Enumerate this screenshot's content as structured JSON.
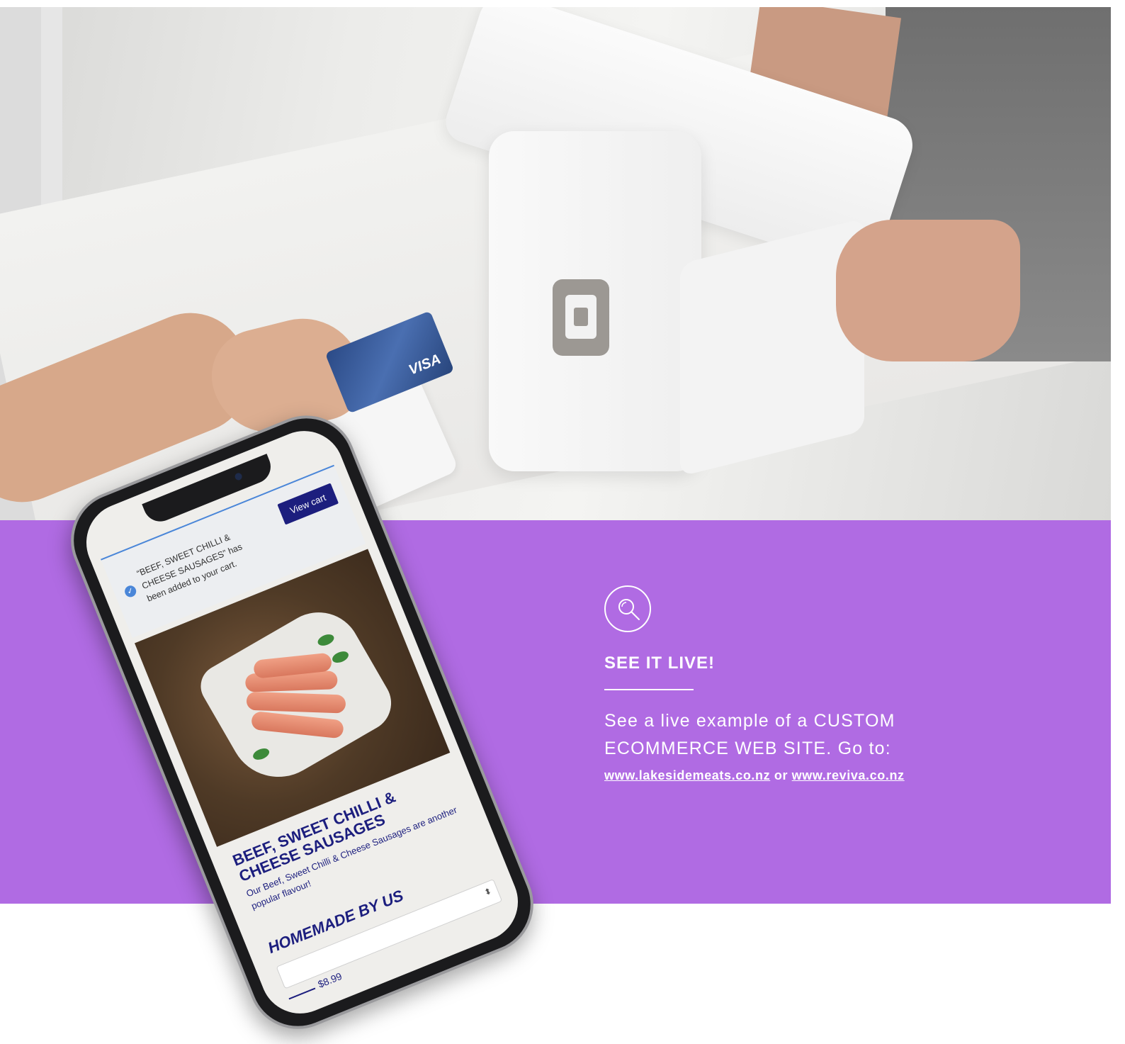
{
  "phone_screen": {
    "notice_message": "“BEEF, SWEET CHILLI & CHEESE SAUSAGES” has been added to your cart.",
    "check_glyph": "✓",
    "view_cart_label": "View cart",
    "product_title": "BEEF, SWEET CHILLI & CHEESE SAUSAGES",
    "product_description": "Our Beef, Sweet Chilli & Cheese Sausages are another popular flavour!",
    "section_heading": "HOMEMADE BY US",
    "select_arrow_glyph": "⬍",
    "price": "$8.99"
  },
  "cta": {
    "icon": "search-icon",
    "heading": "SEE IT LIVE!",
    "body": "See a live example of a CUSTOM ECOMMERCE WEB SITE. Go to:",
    "link1": "www.lakesidemeats.co.nz",
    "separator": "or",
    "link2": "www.reviva.co.nz"
  },
  "hero": {
    "card_brand": "VISA"
  },
  "colors": {
    "purple": "#b06be3",
    "navy": "#1c1e7e",
    "white": "#ffffff"
  }
}
